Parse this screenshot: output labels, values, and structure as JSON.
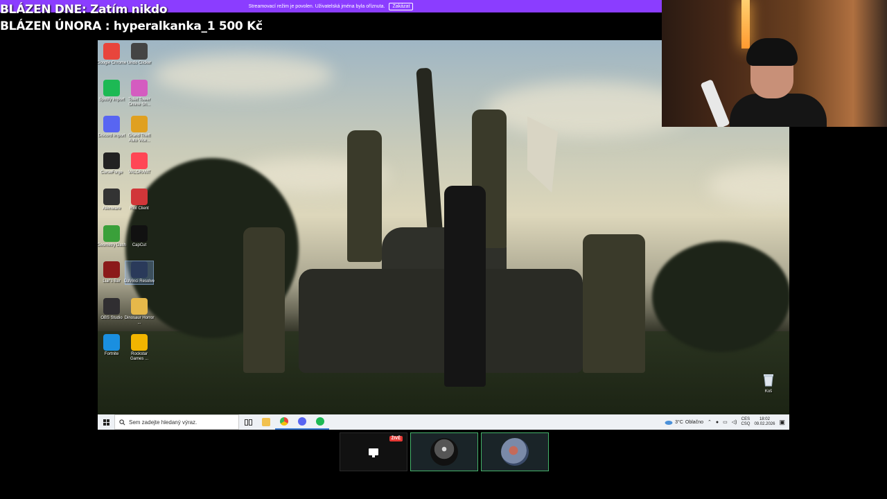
{
  "overlay": {
    "line1": "BLÁZEN DNE: Zatím nikdo",
    "line2": "BLÁZEN ÚNORA : hyperalkanka_1 500 Kč"
  },
  "banner": {
    "message": "Streamovací režim je povolen. Uživatelská jména byla oříznuta.",
    "button": "Zakázat",
    "color": "#8b3dff"
  },
  "desktop_icons": [
    {
      "label": "Google Chrome",
      "icon": "chrome-icon",
      "color": "#e8453c"
    },
    {
      "label": "Undo Clicker",
      "icon": "app-icon",
      "color": "#444444"
    },
    {
      "label": "Spotify Import",
      "icon": "spotify-icon",
      "color": "#1db954"
    },
    {
      "label": "Toilet Tower Online Sh...",
      "icon": "game-icon",
      "color": "#d45cc0"
    },
    {
      "label": "Discord Import",
      "icon": "discord-icon",
      "color": "#5865f2"
    },
    {
      "label": "Grand Theft Auto Vice...",
      "icon": "gta-icon",
      "color": "#e0a020"
    },
    {
      "label": "CurseForge",
      "icon": "anvil-icon",
      "color": "#222222"
    },
    {
      "label": "VALORANT",
      "icon": "valorant-icon",
      "color": "#ff4655"
    },
    {
      "label": "Alienware",
      "icon": "app-icon",
      "color": "#333333"
    },
    {
      "label": "Riot Client",
      "icon": "riot-icon",
      "color": "#d13639"
    },
    {
      "label": "Geometry Dash",
      "icon": "geometry-dash-icon",
      "color": "#3aa03a"
    },
    {
      "label": "CapCut",
      "icon": "capcut-icon",
      "color": "#111111"
    },
    {
      "label": "Liar's Bar",
      "icon": "liars-bar-icon",
      "color": "#8b1a1a"
    },
    {
      "label": "DaVinci Resolve",
      "icon": "davinci-icon",
      "color": "#2a3a5a"
    },
    {
      "label": "OBS Studio",
      "icon": "obs-icon",
      "color": "#302e31"
    },
    {
      "label": "Dinosaur Horror ...",
      "icon": "folder-icon",
      "color": "#e6b84a"
    },
    {
      "label": "Fortnite",
      "icon": "fortnite-icon",
      "color": "#1a8fe0"
    },
    {
      "label": "Rockstar Games ...",
      "icon": "rockstar-icon",
      "color": "#f2b500"
    }
  ],
  "recycle_bin": {
    "label": "Koš",
    "icon": "recycle-bin-icon"
  },
  "taskbar": {
    "search_placeholder": "Sem zadejte hledaný výraz.",
    "weather_temp": "3°C",
    "weather_text": "Oblačno",
    "lang1": "CES",
    "lang2": "CSQ",
    "time": "18:02",
    "date": "09.02.2026"
  },
  "tiles": {
    "live_badge": "ŽIVĚ"
  }
}
